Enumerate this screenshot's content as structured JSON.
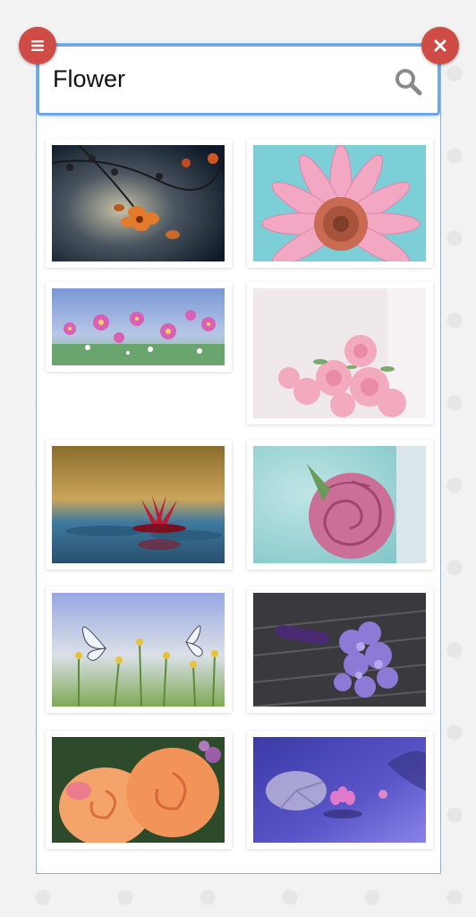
{
  "search": {
    "value": "Flower",
    "placeholder": "Search"
  },
  "buttons": {
    "menu_icon": "menu-icon",
    "close_icon": "close-icon",
    "search_icon": "search-icon"
  },
  "colors": {
    "fab": "#cf4b45",
    "panel_border": "#7db8e8",
    "search_focus": "#6fa6ea"
  },
  "results": [
    {
      "subject": "dark-orange-blossoms"
    },
    {
      "subject": "pink-gerbera-daisy"
    },
    {
      "subject": "wildflower-meadow"
    },
    {
      "subject": "pink-rose-bouquet"
    },
    {
      "subject": "red-water-lily"
    },
    {
      "subject": "pink-rose"
    },
    {
      "subject": "butterflies-meadow"
    },
    {
      "subject": "purple-bouquet"
    },
    {
      "subject": "orange-roses"
    },
    {
      "subject": "water-lily-purple-pond"
    }
  ]
}
